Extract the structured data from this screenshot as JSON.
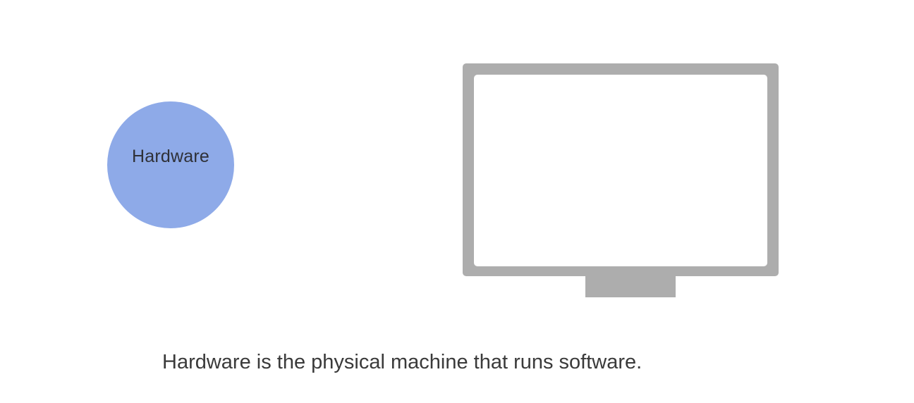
{
  "diagram": {
    "bubble": {
      "label": "Hardware",
      "color": "#8eaae8"
    },
    "monitor": {
      "icon": "computer-monitor-icon",
      "frame_color": "#adadad",
      "screen_color": "#ffffff"
    },
    "caption": "Hardware is the physical machine that runs software."
  }
}
